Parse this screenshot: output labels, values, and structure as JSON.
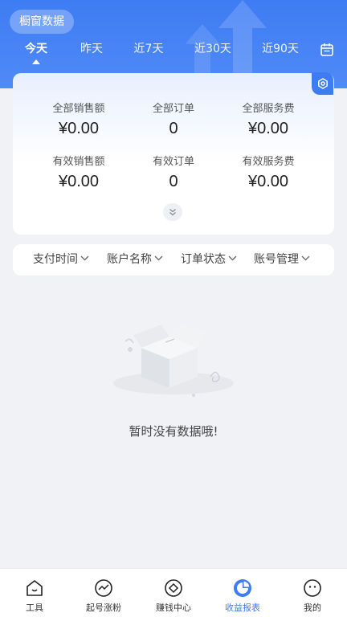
{
  "header": {
    "title": "橱窗数据",
    "tabs": [
      {
        "label": "今天",
        "active": true
      },
      {
        "label": "昨天",
        "active": false
      },
      {
        "label": "近7天",
        "active": false
      },
      {
        "label": "近30天",
        "active": false
      },
      {
        "label": "近90天",
        "active": false
      }
    ],
    "calendar_icon": "calendar-icon"
  },
  "stats": {
    "row1": [
      {
        "label": "全部销售额",
        "value": "¥0.00"
      },
      {
        "label": "全部订单",
        "value": "0"
      },
      {
        "label": "全部服务费",
        "value": "¥0.00"
      }
    ],
    "row2": [
      {
        "label": "有效销售额",
        "value": "¥0.00"
      },
      {
        "label": "有效订单",
        "value": "0"
      },
      {
        "label": "有效服务费",
        "value": "¥0.00"
      }
    ],
    "settings_icon": "settings-icon",
    "expand_icon": "double-chevron-down-icon"
  },
  "filters": [
    {
      "label": "支付时间"
    },
    {
      "label": "账户名称"
    },
    {
      "label": "订单状态"
    },
    {
      "label": "账号管理"
    }
  ],
  "empty": {
    "message": "暂时没有数据哦!",
    "illustration": "empty-box-icon"
  },
  "bottom_nav": [
    {
      "label": "工具",
      "icon": "home-icon",
      "active": false
    },
    {
      "label": "起号涨粉",
      "icon": "trend-icon",
      "active": false
    },
    {
      "label": "赚钱中心",
      "icon": "coin-icon",
      "active": false
    },
    {
      "label": "收益报表",
      "icon": "pie-chart-icon",
      "active": true
    },
    {
      "label": "我的",
      "icon": "profile-icon",
      "active": false
    }
  ],
  "colors": {
    "accent": "#3e7cf4",
    "background": "#f1f2f6",
    "card": "#ffffff"
  }
}
